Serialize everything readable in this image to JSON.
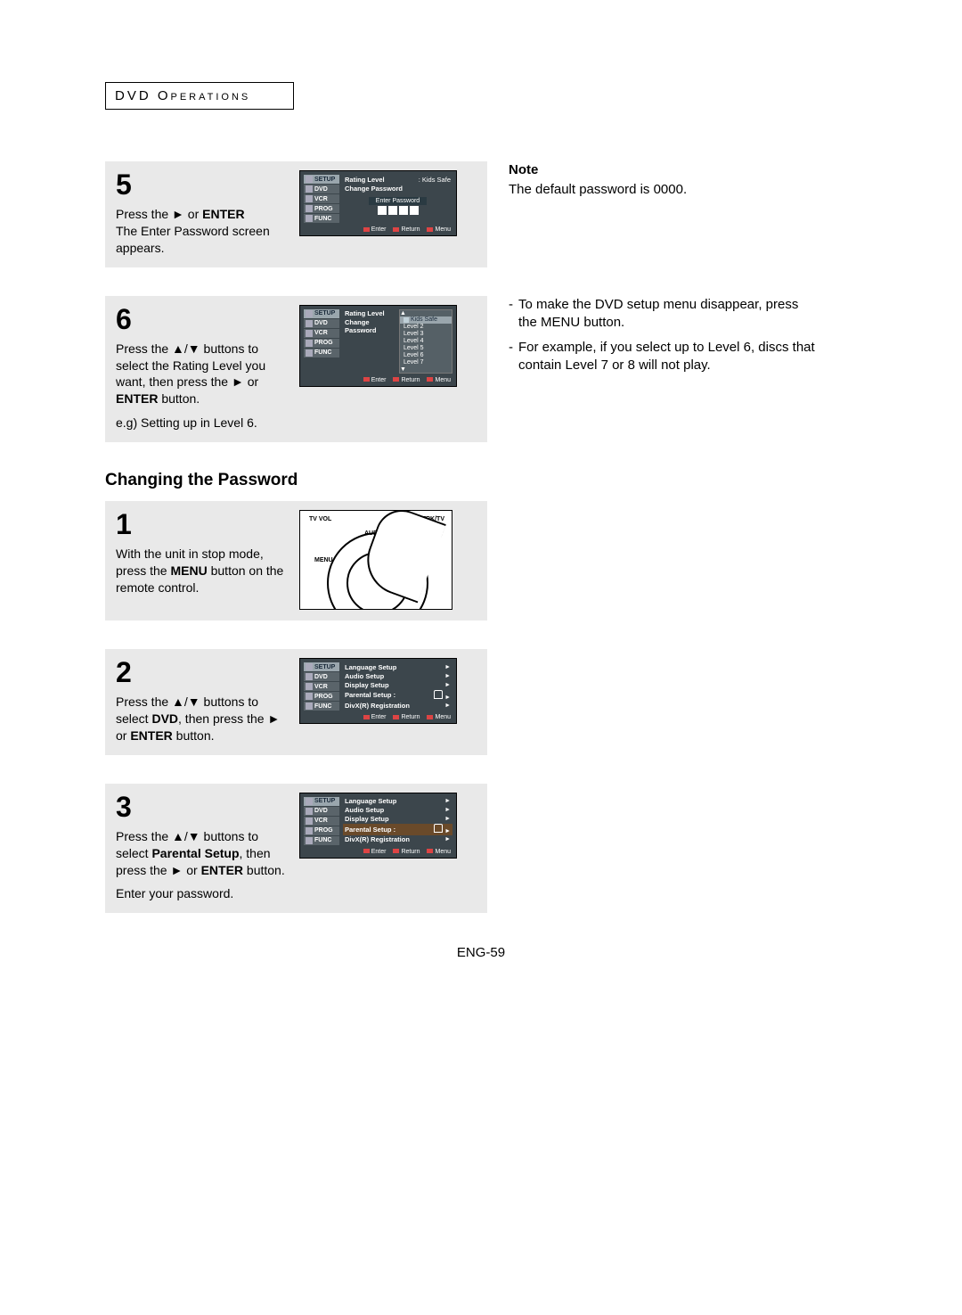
{
  "header": {
    "section_label": "DVD Operations"
  },
  "icons": {
    "play": "►",
    "up": "▲",
    "down": "▼",
    "updown": "▲/▼"
  },
  "step5": {
    "num": "5",
    "text_a": "Press the ",
    "text_b": " or ",
    "text_c": "ENTER",
    "text_d": "The Enter Password screen appears.",
    "osd": {
      "tabs": [
        "SETUP",
        "DVD",
        "VCR",
        "PROG",
        "FUNC"
      ],
      "rows": {
        "rating": "Rating Level",
        "rating_val": ": Kids Safe",
        "change_pw": "Change Password",
        "enter_pw": "Enter Password"
      },
      "footer": [
        "Enter",
        "Return",
        "Menu"
      ]
    }
  },
  "note5": {
    "heading": "Note",
    "body": "The default password is 0000."
  },
  "step6": {
    "num": "6",
    "text_a": "Press the ",
    "text_b": " buttons to select the Rating Level you want, then press the ",
    "text_c": " or ",
    "text_d": "ENTER",
    "text_e": " button.",
    "text_f": "e.g) Setting up in Level 6.",
    "osd": {
      "levels_title": "Kids Safe",
      "levels": [
        "Level 2",
        "Level 3",
        "Level 4",
        "Level 5",
        "Level 6",
        "Level 7"
      ]
    }
  },
  "note6": {
    "items": [
      "To make the DVD setup menu disappear, press the MENU button.",
      "For example, if you select up to Level 6, discs that contain Level 7 or 8 will not play."
    ]
  },
  "changing_heading": "Changing the Password",
  "cp1": {
    "num": "1",
    "text_a": "With the unit in stop mode, press the ",
    "text_b": "MENU",
    "text_c": " button on the remote control.",
    "remote": {
      "tvvol": "TV VOL",
      "trk": "TRK/TV",
      "audio": "AUDIO",
      "menu": "MENU"
    }
  },
  "cp2": {
    "num": "2",
    "text_a": "Press the ",
    "text_b": " buttons to select ",
    "text_c": "DVD",
    "text_d": ", then press the ",
    "text_e": " or ",
    "text_f": "ENTER",
    "text_g": " button.",
    "osd": {
      "items": [
        "Language  Setup",
        "Audio  Setup",
        "Display  Setup",
        "Parental  Setup :",
        "DivX(R) Registration"
      ]
    }
  },
  "cp3": {
    "num": "3",
    "text_a": "Press the ",
    "text_b": " buttons to select ",
    "text_c": "Parental Setup",
    "text_d": ", then press the ",
    "text_e": " or ",
    "text_f": "ENTER",
    "text_g": " button.",
    "text_h": "Enter your password."
  },
  "page_number": "ENG-59"
}
